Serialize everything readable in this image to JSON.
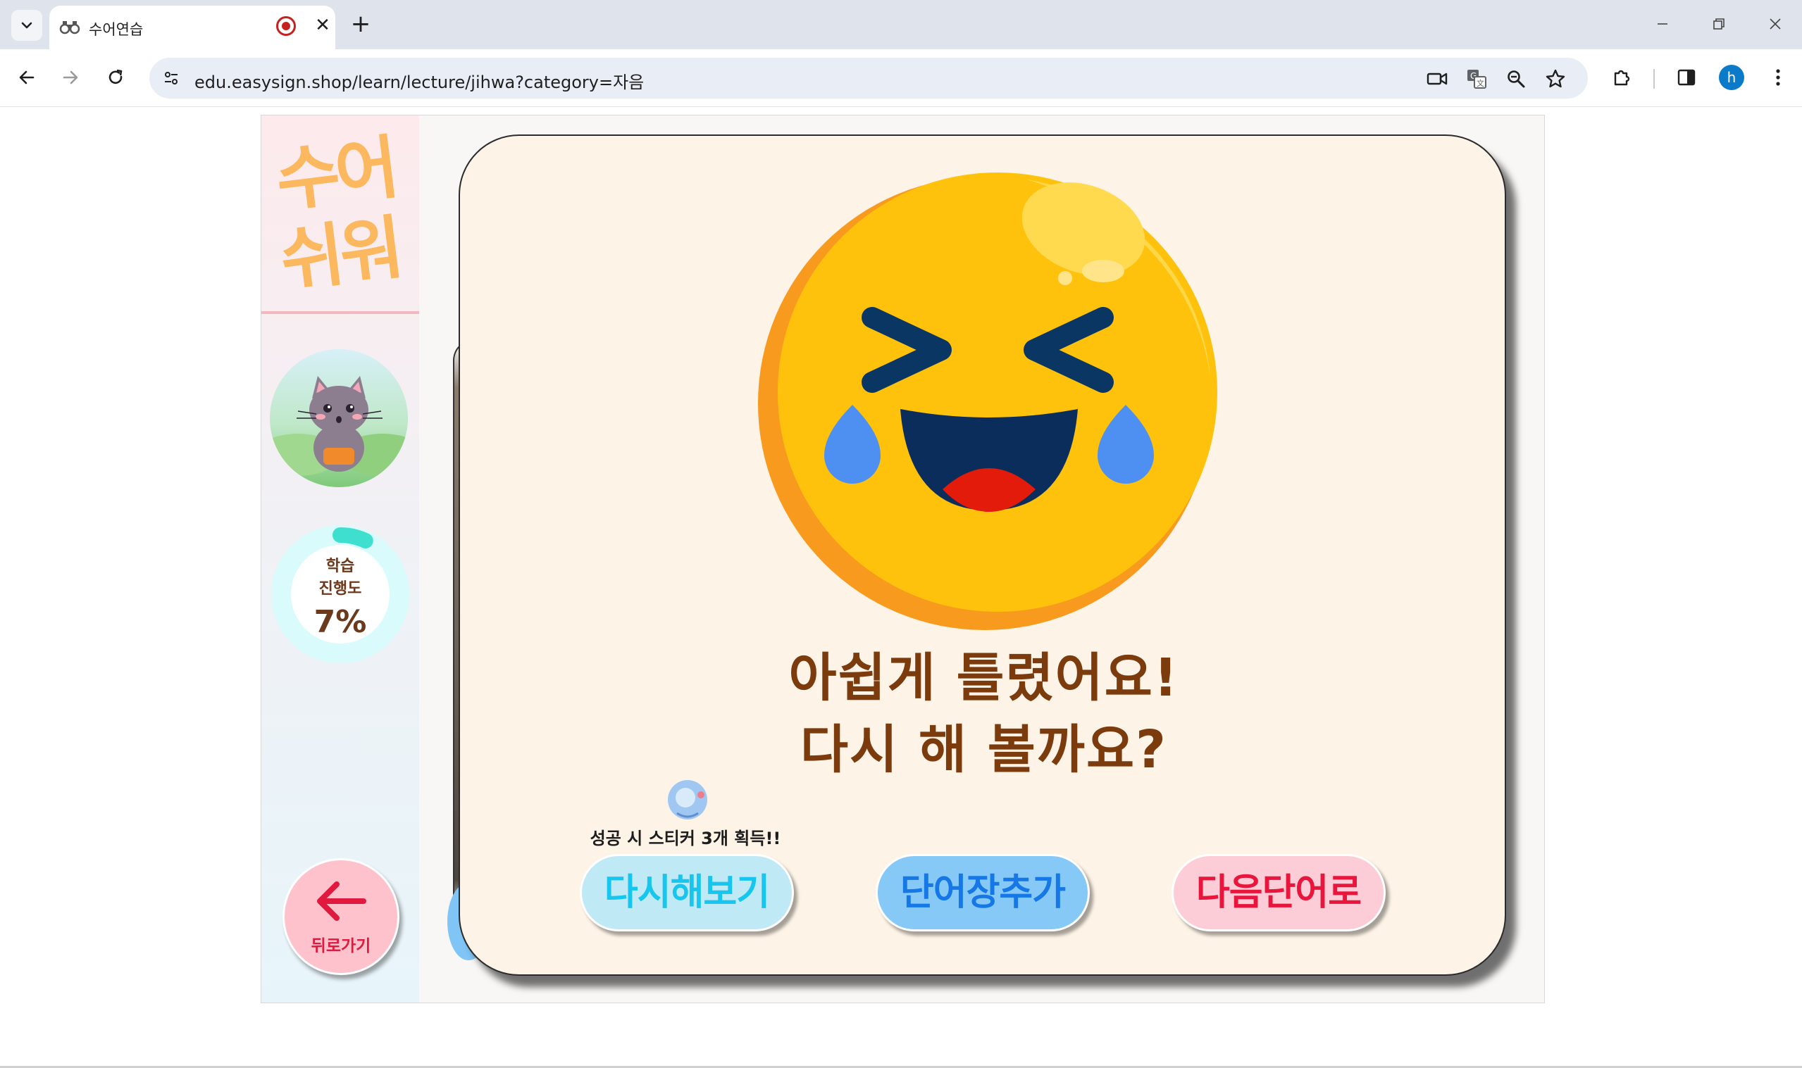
{
  "browser": {
    "tab_title": "수어연습",
    "url": "edu.easysign.shop/learn/lecture/jihwa?category=자음",
    "profile_initial": "h",
    "new_tab_label": "+",
    "close_label": "✕"
  },
  "sidebar": {
    "logo": "수어쉬워",
    "progress": {
      "label_line1": "학습",
      "label_line2": "진행도",
      "value_text": "7%",
      "value": 7
    },
    "back_button_label": "뒤로가기"
  },
  "modal": {
    "message_line1": "아쉽게 틀렸어요!",
    "message_line2": "다시 해 볼까요?",
    "sticker_note": "성공 시 스티커 3개 획득!!",
    "buttons": {
      "retry": "다시해보기",
      "add_vocab": "단어장추가",
      "next_word": "다음단어로"
    }
  },
  "colors": {
    "message": "#7b3b0c",
    "retry": "#17c6ee",
    "add_vocab": "#1578e6",
    "next_word": "#e8163c",
    "logo": "#fbb85f",
    "progress_fill": "#3fdfd0"
  }
}
